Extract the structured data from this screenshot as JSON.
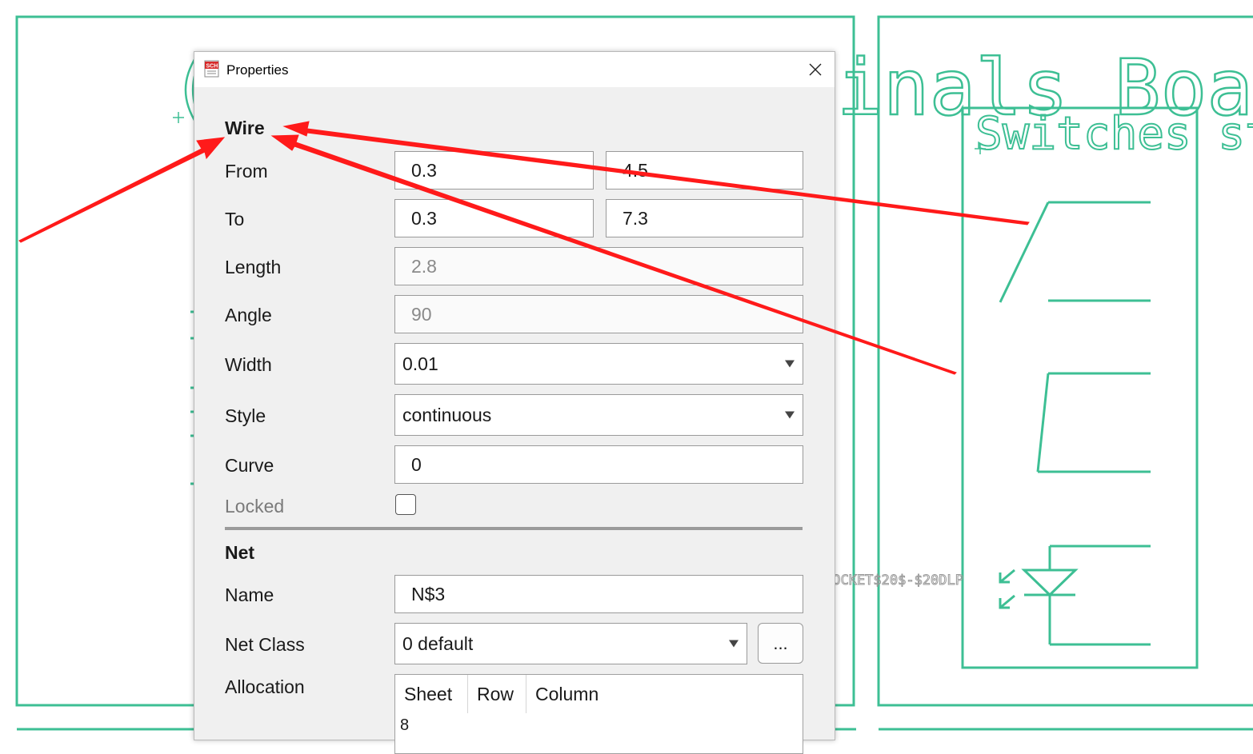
{
  "schematic": {
    "title_fragment_left": "(",
    "title_fragment_right": "inals Board)",
    "subtitle": "Switches state",
    "part_label": "SOCKET$20$-$20DLP",
    "line_color": "#3dbf94"
  },
  "dialog": {
    "title": "Properties",
    "icon": "sch-app-icon",
    "close": "close-icon",
    "wire_section": {
      "heading": "Wire",
      "from_label": "From",
      "from_x": "0.3",
      "from_y": "4.5",
      "to_label": "To",
      "to_x": "0.3",
      "to_y": "7.3",
      "length_label": "Length",
      "length": "2.8",
      "angle_label": "Angle",
      "angle": "90",
      "width_label": "Width",
      "width": "0.01",
      "style_label": "Style",
      "style": "continuous",
      "curve_label": "Curve",
      "curve": "0",
      "locked_label": "Locked",
      "locked": false
    },
    "net_section": {
      "heading": "Net",
      "name_label": "Name",
      "name": "N$3",
      "net_class_label": "Net Class",
      "net_class": "0 default",
      "net_class_button": "...",
      "allocation_label": "Allocation",
      "allocation_columns": [
        "Sheet",
        "Row",
        "Column"
      ],
      "allocation_rows": [
        [
          "8",
          "",
          ""
        ]
      ]
    }
  },
  "annotation": {
    "arrow_color": "#ff1a1a"
  }
}
